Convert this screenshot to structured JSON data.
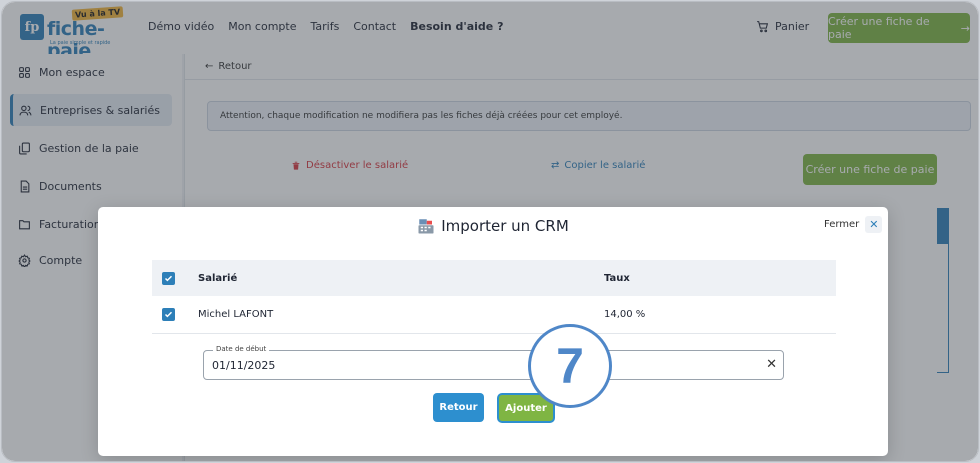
{
  "header": {
    "logo": {
      "badge": "fp",
      "brand": "fiche-paie",
      "tv_badge": "Vu à la TV",
      "tagline": "La paie simple et rapide"
    },
    "nav": [
      "Démo vidéo",
      "Mon compte",
      "Tarifs",
      "Contact",
      "Besoin d'aide ?"
    ],
    "cart_label": "Panier",
    "cta_label": "Créer une fiche de paie"
  },
  "sidebar": {
    "items": [
      {
        "label": "Mon espace",
        "icon": "grid-icon"
      },
      {
        "label": "Entreprises & salariés",
        "icon": "users-icon",
        "active": true
      },
      {
        "label": "Gestion de la paie",
        "icon": "files-icon"
      },
      {
        "label": "Documents",
        "icon": "document-icon"
      },
      {
        "label": "Facturation",
        "icon": "folder-icon"
      },
      {
        "label": "Compte",
        "icon": "gear-icon"
      }
    ]
  },
  "main": {
    "back_label": "Retour",
    "alert": "Attention, chaque modification ne modifiera pas les fiches déjà créées pour cet employé.",
    "deactivate_label": "Désactiver le salarié",
    "copy_label": "Copier le salarié",
    "cta_label": "Créer une fiche de paie"
  },
  "modal": {
    "title": "Importer un CRM",
    "close_label": "Fermer",
    "table": {
      "headers": [
        "Salarié",
        "Taux"
      ],
      "rows": [
        {
          "name": "Michel LAFONT",
          "rate": "14,00 %",
          "checked": true
        }
      ]
    },
    "date_field": {
      "label": "Date de début",
      "value": "01/11/2025"
    },
    "back_button": "Retour",
    "add_button": "Ajouter"
  },
  "step_number": "7",
  "colors": {
    "accent": "#2d7fb8",
    "cta_green": "#7fb543",
    "danger": "#d9363e",
    "step_blue": "#4f87c8"
  }
}
